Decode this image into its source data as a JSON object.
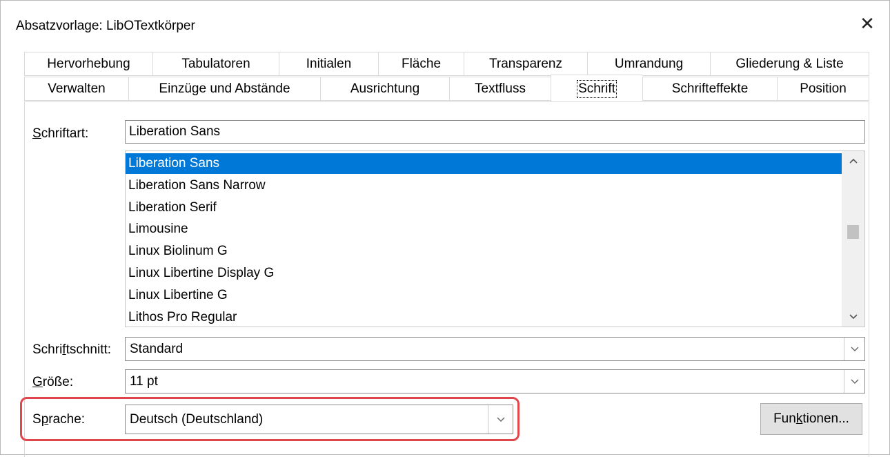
{
  "window": {
    "title": "Absatzvorlage: LibOTextkörper",
    "close_label": "✕"
  },
  "tabs": {
    "row1": [
      {
        "label": "Hervorhebung"
      },
      {
        "label": "Tabulatoren"
      },
      {
        "label": "Initialen"
      },
      {
        "label": "Fläche"
      },
      {
        "label": "Transparenz"
      },
      {
        "label": "Umrandung"
      },
      {
        "label": "Gliederung & Liste"
      }
    ],
    "row2": [
      {
        "label": "Verwalten"
      },
      {
        "label": "Einzüge und Abstände"
      },
      {
        "label": "Ausrichtung"
      },
      {
        "label": "Textfluss"
      },
      {
        "label": "Schrift",
        "active": true
      },
      {
        "label": "Schrifteffekte"
      },
      {
        "label": "Position"
      }
    ]
  },
  "font": {
    "label_pre": "",
    "label_u": "S",
    "label_post": "chriftart:",
    "value": "Liberation Sans",
    "list": [
      {
        "name": "Liberation Sans",
        "selected": true
      },
      {
        "name": "Liberation Sans Narrow"
      },
      {
        "name": "Liberation Serif"
      },
      {
        "name": "Limousine"
      },
      {
        "name": "Linux Biolinum G"
      },
      {
        "name": "Linux Libertine Display G"
      },
      {
        "name": "Linux Libertine G"
      },
      {
        "name": "Lithos Pro Regular"
      }
    ]
  },
  "style": {
    "label_pre": "Schri",
    "label_u": "f",
    "label_post": "tschnitt:",
    "value": "Standard"
  },
  "size": {
    "label_pre": "",
    "label_u": "G",
    "label_post": "röße:",
    "value": "11 pt"
  },
  "language": {
    "label_pre": "S",
    "label_u": "p",
    "label_post": "rache:",
    "value": "Deutsch (Deutschland)"
  },
  "features_button": {
    "label_pre": "Fun",
    "label_u": "k",
    "label_post": "tionen..."
  },
  "icons": {
    "scroll_up": "up-chevron",
    "scroll_down": "down-chevron",
    "dropdown": "chevron-down"
  },
  "colors": {
    "selection": "#0078d7",
    "highlight_border": "#e0474c"
  }
}
